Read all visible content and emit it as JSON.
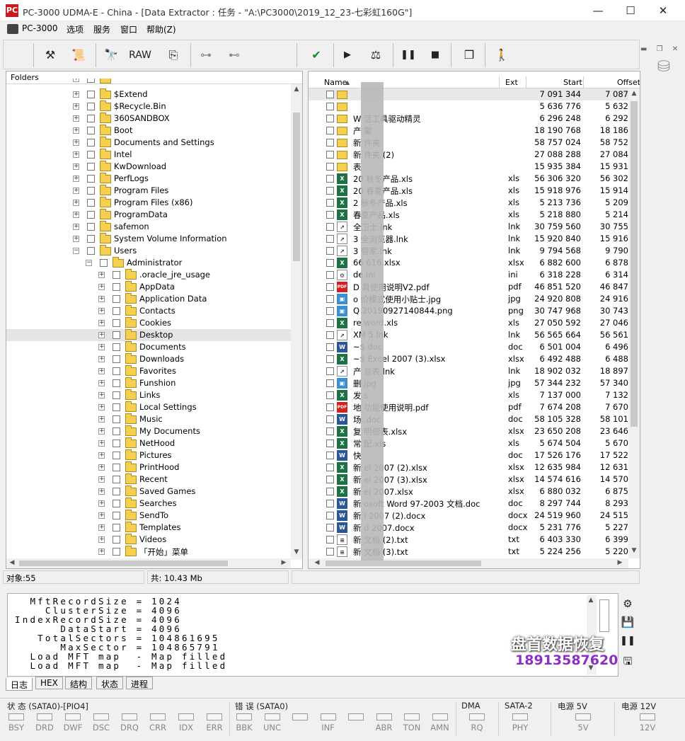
{
  "window": {
    "title": "PC-3000 UDMA-E - China - [Data Extractor : 任务 - \"A:\\PC3000\\2019_12_23-七彩虹160G\"]",
    "app_icon_text": "PC",
    "minimize": "—",
    "maximize": "☐",
    "close": "✕"
  },
  "menu": [
    "PC-3000",
    "选项",
    "服务",
    "窗口",
    "帮助(Z)"
  ],
  "toolbar": {
    "raw_label": "RAW"
  },
  "folders": {
    "header": "Folders",
    "rows": [
      {
        "label": "$Extend",
        "level": 0
      },
      {
        "label": "$Recycle.Bin",
        "level": 0
      },
      {
        "label": "360SANDBOX",
        "level": 0
      },
      {
        "label": "Boot",
        "level": 0
      },
      {
        "label": "Documents and Settings",
        "level": 0
      },
      {
        "label": "Intel",
        "level": 0
      },
      {
        "label": "KwDownload",
        "level": 0
      },
      {
        "label": "PerfLogs",
        "level": 0
      },
      {
        "label": "Program Files",
        "level": 0
      },
      {
        "label": "Program Files (x86)",
        "level": 0
      },
      {
        "label": "ProgramData",
        "level": 0
      },
      {
        "label": "safemon",
        "level": 0
      },
      {
        "label": "System Volume Information",
        "level": 0
      },
      {
        "label": "Users",
        "level": 0,
        "expanded": true
      },
      {
        "label": "Administrator",
        "level": 1,
        "expanded": true
      },
      {
        "label": ".oracle_jre_usage",
        "level": 2
      },
      {
        "label": "AppData",
        "level": 2
      },
      {
        "label": "Application Data",
        "level": 2
      },
      {
        "label": "Contacts",
        "level": 2
      },
      {
        "label": "Cookies",
        "level": 2
      },
      {
        "label": "Desktop",
        "level": 2,
        "selected": true
      },
      {
        "label": "Documents",
        "level": 2
      },
      {
        "label": "Downloads",
        "level": 2
      },
      {
        "label": "Favorites",
        "level": 2
      },
      {
        "label": "Funshion",
        "level": 2
      },
      {
        "label": "Links",
        "level": 2
      },
      {
        "label": "Local Settings",
        "level": 2
      },
      {
        "label": "Music",
        "level": 2
      },
      {
        "label": "My Documents",
        "level": 2
      },
      {
        "label": "NetHood",
        "level": 2
      },
      {
        "label": "Pictures",
        "level": 2
      },
      {
        "label": "PrintHood",
        "level": 2
      },
      {
        "label": "Recent",
        "level": 2
      },
      {
        "label": "Saved Games",
        "level": 2
      },
      {
        "label": "Searches",
        "level": 2
      },
      {
        "label": "SendTo",
        "level": 2
      },
      {
        "label": "Templates",
        "level": 2
      },
      {
        "label": "Videos",
        "level": 2
      },
      {
        "label": "「开始」菜单",
        "level": 2
      }
    ]
  },
  "files": {
    "columns": {
      "name": "Name",
      "ext": "Ext",
      "start": "Start",
      "offset": "Offset"
    },
    "rows": [
      {
        "name": "",
        "ext": "",
        "start": "7 091 344",
        "offset": "7 087",
        "icon": "folder"
      },
      {
        "name": "",
        "ext": "",
        "start": "5 636 776",
        "offset": "5 632",
        "icon": "folder"
      },
      {
        "name": "W        活工具驱动精灵",
        "ext": "",
        "start": "6 296 248",
        "offset": "6 292",
        "icon": "folder"
      },
      {
        "name": "产        案",
        "ext": "",
        "start": "18 190 768",
        "offset": "18 186",
        "icon": "folder"
      },
      {
        "name": "新        件夹",
        "ext": "",
        "start": "58 757 024",
        "offset": "58 752",
        "icon": "folder"
      },
      {
        "name": "新        件夹 (2)",
        "ext": "",
        "start": "27 088 288",
        "offset": "27 084",
        "icon": "folder"
      },
      {
        "name": "表",
        "ext": "",
        "start": "15 935 384",
        "offset": "15 931",
        "icon": "folder"
      },
      {
        "name": "20        秋冬产品.xls",
        "ext": "xls",
        "start": "56 306 320",
        "offset": "56 302",
        "icon": "xls"
      },
      {
        "name": "20        春夏产品.xls",
        "ext": "xls",
        "start": "15 918 976",
        "offset": "15 914",
        "icon": "xls"
      },
      {
        "name": "2        秋冬产品.xls",
        "ext": "xls",
        "start": "5 213 736",
        "offset": "5 209",
        "icon": "xls"
      },
      {
        "name": "        春夏产品.xls",
        "ext": "xls",
        "start": "5 218 880",
        "offset": "5 214",
        "icon": "xls"
      },
      {
        "name": "        全卫士.lnk",
        "ext": "lnk",
        "start": "30 759 560",
        "offset": "30 755",
        "icon": "lnk"
      },
      {
        "name": "3        全浏览器.lnk",
        "ext": "lnk",
        "start": "15 920 840",
        "offset": "15 916",
        "icon": "lnk"
      },
      {
        "name": "3        管家.lnk",
        "ext": "lnk",
        "start": "9 794 568",
        "offset": "9 790",
        "icon": "lnk"
      },
      {
        "name": "66        616.xlsx",
        "ext": "xlsx",
        "start": "6 882 600",
        "offset": "6 878",
        "icon": "xls"
      },
      {
        "name": "de        ini",
        "ext": "ini",
        "start": "6 318 228",
        "offset": "6 314",
        "icon": "ini"
      },
      {
        "name": "D        具使用说明V2.pdf",
        "ext": "pdf",
        "start": "46 851 520",
        "offset": "46 847",
        "icon": "pdf"
      },
      {
        "name": "o        价模式使用小贴士.jpg",
        "ext": "jpg",
        "start": "24 920 808",
        "offset": "24 916",
        "icon": "img"
      },
      {
        "name": "Q        20190927140844.png",
        "ext": "png",
        "start": "30 747 968",
        "offset": "30 743",
        "icon": "img"
      },
      {
        "name": "re        word.xls",
        "ext": "xls",
        "start": "27 050 592",
        "offset": "27 046",
        "icon": "xls"
      },
      {
        "name": "XM        5.lnk",
        "ext": "lnk",
        "start": "56 565 664",
        "offset": "56 561",
        "icon": "lnk"
      },
      {
        "name": "~$        doc",
        "ext": "doc",
        "start": "6 501 004",
        "offset": "6 496",
        "icon": "doc"
      },
      {
        "name": "~$        Excel 2007 (3).xlsx",
        "ext": "xlsx",
        "start": "6 492 488",
        "offset": "6 488",
        "icon": "xls"
      },
      {
        "name": "产        总表.lnk",
        "ext": "lnk",
        "start": "18 902 032",
        "offset": "18 897",
        "icon": "lnk"
      },
      {
        "name": "删        jpg",
        "ext": "jpg",
        "start": "57 344 232",
        "offset": "57 340",
        "icon": "img"
      },
      {
        "name": "发        s",
        "ext": "xls",
        "start": "7 137 000",
        "offset": "7 132",
        "icon": "xls"
      },
      {
        "name": "地        功能使用说明.pdf",
        "ext": "pdf",
        "start": "7 674 208",
        "offset": "7 670",
        "icon": "pdf"
      },
      {
        "name": "场        .doc",
        "ext": "doc",
        "start": "58 105 328",
        "offset": "58 101",
        "icon": "doc"
      },
      {
        "name": "复        明细表.xlsx",
        "ext": "xlsx",
        "start": "23 650 208",
        "offset": "23 646",
        "icon": "xls"
      },
      {
        "name": "常        配.xls",
        "ext": "xls",
        "start": "5 674 504",
        "offset": "5 670",
        "icon": "xls"
      },
      {
        "name": "快",
        "ext": "doc",
        "start": "17 526 176",
        "offset": "17 522",
        "icon": "doc"
      },
      {
        "name": "新        el 2007 (2).xlsx",
        "ext": "xlsx",
        "start": "12 635 984",
        "offset": "12 631",
        "icon": "xls"
      },
      {
        "name": "新        el 2007 (3).xlsx",
        "ext": "xlsx",
        "start": "14 574 616",
        "offset": "14 570",
        "icon": "xls"
      },
      {
        "name": "新        el 2007.xlsx",
        "ext": "xlsx",
        "start": "6 880 032",
        "offset": "6 875",
        "icon": "xls"
      },
      {
        "name": "新        osoft Word 97-2003 文档.doc",
        "ext": "doc",
        "start": "8 297 744",
        "offset": "8 293",
        "icon": "doc"
      },
      {
        "name": "新        l 2007 (2).docx",
        "ext": "docx",
        "start": "24 519 960",
        "offset": "24 515",
        "icon": "doc"
      },
      {
        "name": "新        d 2007.docx",
        "ext": "docx",
        "start": "5 231 776",
        "offset": "5 227",
        "icon": "doc"
      },
      {
        "name": "新        文档 (2).txt",
        "ext": "txt",
        "start": "6 403 330",
        "offset": "6 399",
        "icon": "txt"
      },
      {
        "name": "新        文档 (3).txt",
        "ext": "txt",
        "start": "5 224 256",
        "offset": "5 220",
        "icon": "txt"
      }
    ]
  },
  "status": {
    "objects": "对象:55",
    "total": "共: 10.43 Mb"
  },
  "log": {
    "lines": [
      "  MftRecordSize = 1024",
      "    ClusterSize = 4096",
      "IndexRecordSize = 4096",
      "      DataStart = 4096",
      "   TotalSectors = 104861695",
      "      MaxSector = 104865791",
      "  Load MFT map  - Map filled",
      "  Load MFT map  - Map filled"
    ],
    "tabs": [
      "日志",
      "HEX",
      "结构",
      "状态",
      "进程"
    ]
  },
  "watermark": {
    "line1": "盘首数据恢复",
    "line2": "18913587620"
  },
  "registers": {
    "status_title": "状 态 (SATA0)-[PIO4]",
    "status_bits": [
      "BSY",
      "DRD",
      "DWF",
      "DSC",
      "DRQ",
      "CRR",
      "IDX",
      "ERR"
    ],
    "error_title": "错 误 (SATA0)",
    "error_bits": [
      "BBK",
      "UNC",
      "",
      "INF",
      "",
      "ABR",
      "TON",
      "AMN"
    ],
    "dma_title": "DMA",
    "dma_bits": [
      "RQ"
    ],
    "sata_title": "SATA-2",
    "sata_bits": [
      "PHY"
    ],
    "p5_title": "电源 5V",
    "p5_bits": [
      "5V"
    ],
    "p12_title": "电源 12V",
    "p12_bits": [
      "12V"
    ]
  }
}
